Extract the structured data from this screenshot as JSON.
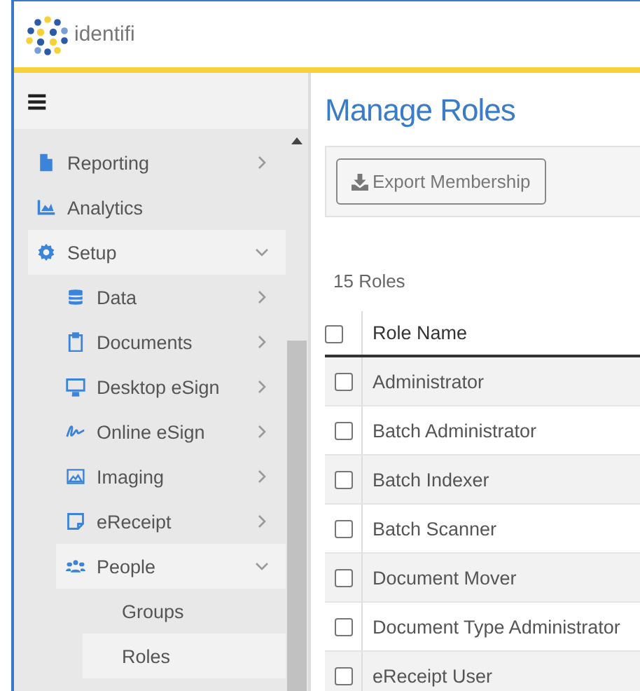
{
  "header": {
    "logo_text": "identifi"
  },
  "sidebar": {
    "menu_glyph": "≡",
    "items": [
      {
        "label": "Reporting",
        "expanded": false
      },
      {
        "label": "Analytics"
      },
      {
        "label": "Setup",
        "expanded": true,
        "children": [
          {
            "label": "Data",
            "expanded": false
          },
          {
            "label": "Documents",
            "expanded": false
          },
          {
            "label": "Desktop eSign",
            "expanded": false
          },
          {
            "label": "Online eSign",
            "expanded": false
          },
          {
            "label": "Imaging",
            "expanded": false
          },
          {
            "label": "eReceipt",
            "expanded": false
          },
          {
            "label": "People",
            "expanded": true,
            "children": [
              {
                "label": "Groups",
                "selected": false
              },
              {
                "label": "Roles",
                "selected": true
              }
            ]
          }
        ]
      }
    ]
  },
  "page": {
    "title": "Manage Roles",
    "toolbar": {
      "buttons": [
        "Export Membership"
      ]
    },
    "count": "15 Roles",
    "table": {
      "columns": [
        "Role Name"
      ],
      "header_checked": false,
      "rows": [
        {
          "name": "Administrator",
          "checked": false
        },
        {
          "name": "Batch Administrator",
          "checked": false
        },
        {
          "name": "Batch Indexer",
          "checked": false
        },
        {
          "name": "Batch Scanner",
          "checked": false
        },
        {
          "name": "Document Mover",
          "checked": false
        },
        {
          "name": "Document Type Administrator",
          "checked": false
        },
        {
          "name": "eReceipt User",
          "checked": false
        }
      ]
    }
  }
}
